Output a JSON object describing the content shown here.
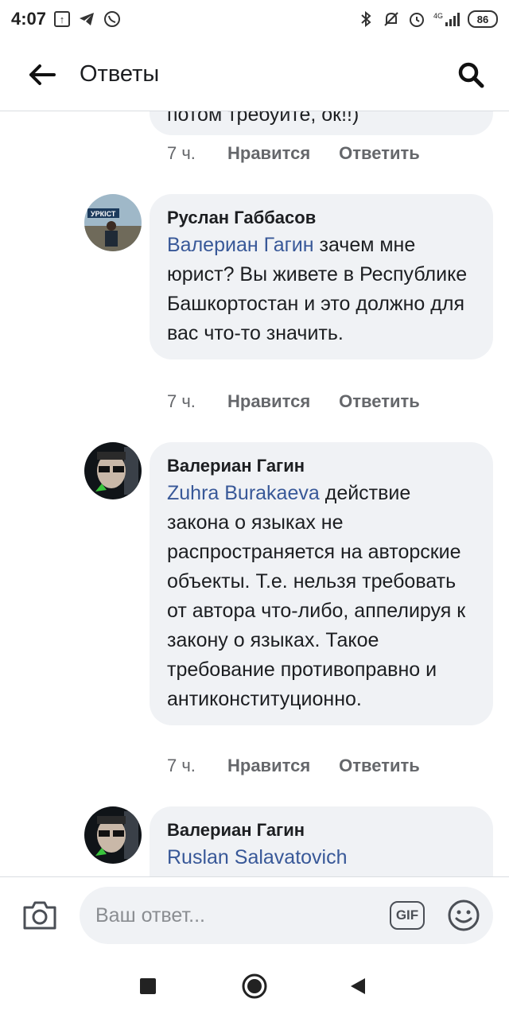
{
  "status_bar": {
    "time": "4:07",
    "upload_icon": "upload-box-icon",
    "telegram_icon": "telegram-icon",
    "whatsapp_icon": "whatsapp-icon",
    "network": "4G",
    "battery": "86"
  },
  "header": {
    "title": "Ответы",
    "back_icon": "arrow-left-icon",
    "search_icon": "search-icon"
  },
  "comments": [
    {
      "text_partial": "потом требуйте, ок!!)",
      "time": "7 ч.",
      "like": "Нравится",
      "reply": "Ответить"
    },
    {
      "author": "Руслан Габбасов",
      "mention": "Валериан Гагин",
      "text": " зачем мне юрист? Вы живете в Республике Башкортостан и это должно для вас что-то значить.",
      "time": "7 ч.",
      "like": "Нравится",
      "reply": "Ответить"
    },
    {
      "author": "Валериан Гагин",
      "mention": "Zuhra  Burakaeva",
      "text": " действие закона о языках не распространяется на авторские объекты. Т.е. нельзя требовать от автора что-либо, аппелируя к закону о языках. Такое требование противоправно и антиконституционно.",
      "time": "7 ч.",
      "like": "Нравится",
      "reply": "Ответить"
    },
    {
      "author": "Валериан Гагин",
      "mention": "Ruslan Salavatovich",
      "text": ""
    }
  ],
  "composer": {
    "placeholder": "Ваш ответ...",
    "gif_label": "GIF"
  }
}
